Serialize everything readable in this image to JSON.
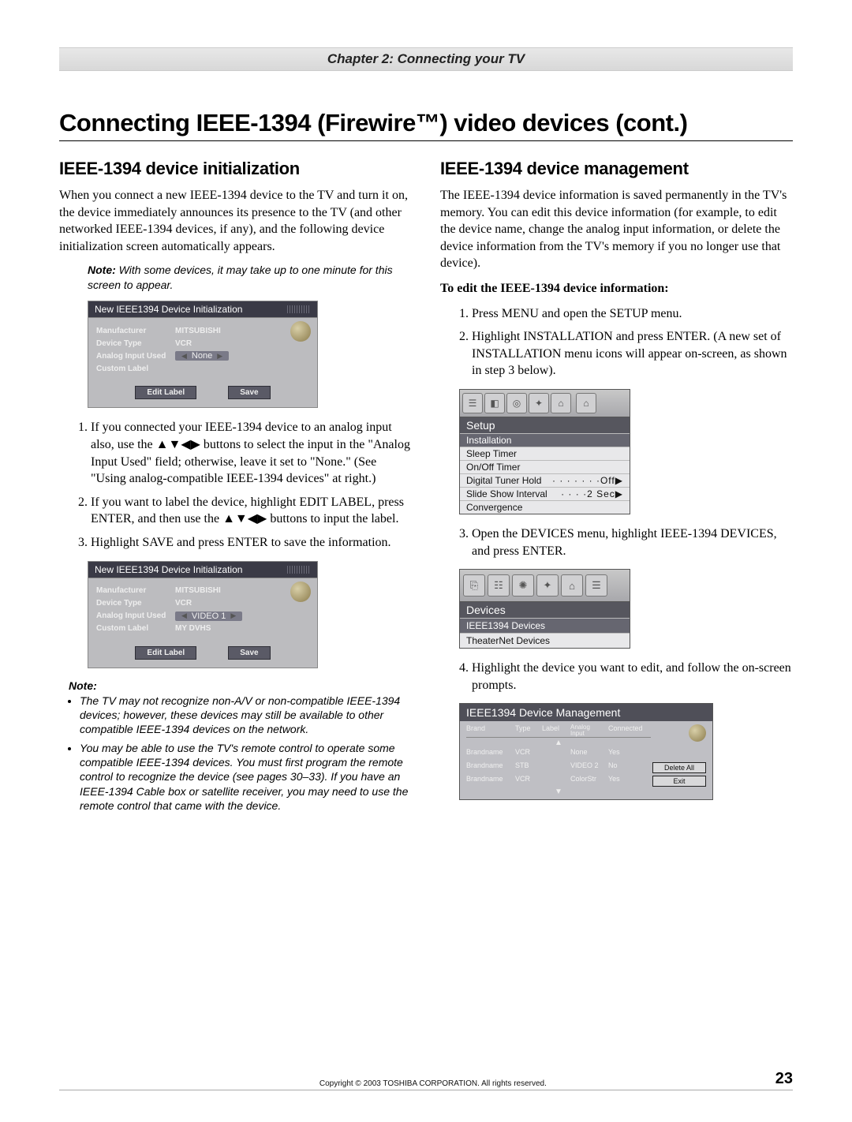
{
  "chapter_bar": "Chapter 2: Connecting your TV",
  "main_title": "Connecting IEEE-1394 (Firewire™) video devices (cont.)",
  "left": {
    "heading": "IEEE-1394 device initialization",
    "intro": "When you connect a new IEEE-1394 device to the TV and turn it on, the device immediately announces its presence to the TV (and other networked IEEE-1394 devices, if any), and the following device initialization screen automatically appears.",
    "note_lead": "Note:",
    "note_text": " With some devices, it may take up to one minute for this screen to appear.",
    "osd1": {
      "title": "New IEEE1394 Device Initialization",
      "rows": {
        "manufacturer_label": "Manufacturer",
        "manufacturer_value": "MITSUBISHI",
        "type_label": "Device Type",
        "type_value": "VCR",
        "analog_label": "Analog Input Used",
        "analog_value": "None",
        "custom_label": "Custom Label",
        "custom_value": ""
      },
      "btn_edit": "Edit Label",
      "btn_save": "Save"
    },
    "steps": [
      "If you connected your IEEE-1394 device to an analog input also, use the ▲▼◀▶ buttons to select the input in the \"Analog Input Used\" field; otherwise, leave it set to \"None.\" (See \"Using analog-compatible IEEE-1394 devices\" at right.)",
      "If you want to label the device, highlight EDIT LABEL, press ENTER, and then use the ▲▼◀▶ buttons to input the label.",
      "Highlight SAVE and press ENTER to save the information."
    ],
    "osd2": {
      "title": "New IEEE1394 Device Initialization",
      "rows": {
        "manufacturer_label": "Manufacturer",
        "manufacturer_value": "MITSUBISHI",
        "type_label": "Device Type",
        "type_value": "VCR",
        "analog_label": "Analog Input Used",
        "analog_value": "VIDEO 1",
        "custom_label": "Custom Label",
        "custom_value": "MY DVHS"
      },
      "btn_edit": "Edit Label",
      "btn_save": "Save"
    },
    "note2_head": "Note:",
    "note2_items": [
      "The TV may not recognize non-A/V or non-compatible IEEE-1394 devices; however, these devices may still be available to other compatible IEEE-1394 devices on the network.",
      "You may be able to use the TV's remote control to operate some compatible IEEE-1394 devices. You must first program the remote control to recognize the device (see pages 30–33). If you have an IEEE-1394 Cable box or satellite receiver, you may need to use the remote control that came with the device."
    ]
  },
  "right": {
    "heading": "IEEE-1394 device management",
    "intro": "The IEEE-1394 device information is saved permanently in the TV's memory. You can edit this device information (for example, to edit the device name, change the analog input information, or delete the device information from the TV's memory if you no longer use that device).",
    "subhead": "To edit the IEEE-1394 device information:",
    "steps12": [
      "Press MENU and open the SETUP menu.",
      "Highlight INSTALLATION and press ENTER. (A new set of INSTALLATION menu icons will appear on-screen, as shown in step 3 below)."
    ],
    "setup_menu": {
      "hdr": "Setup",
      "items": [
        {
          "label": "Installation",
          "hi": true,
          "suffix": ""
        },
        {
          "label": "Sleep Timer",
          "hi": false,
          "suffix": ""
        },
        {
          "label": "On/Off Timer",
          "hi": false,
          "suffix": ""
        },
        {
          "label": "Digital Tuner Hold",
          "hi": false,
          "suffix": "· · · · · · ·Off▶"
        },
        {
          "label": "Slide Show Interval",
          "hi": false,
          "suffix": "· · · ·2 Sec▶"
        },
        {
          "label": "Convergence",
          "hi": false,
          "suffix": ""
        }
      ]
    },
    "step3": "Open the DEVICES menu, highlight IEEE-1394 DEVICES, and press ENTER.",
    "devices_menu": {
      "hdr": "Devices",
      "items": [
        {
          "label": "IEEE1394 Devices",
          "hi": true
        },
        {
          "label": "TheaterNet Devices",
          "hi": false
        }
      ]
    },
    "step4": "Highlight the device you want to edit, and follow the on-screen prompts.",
    "mgmt": {
      "hdr": "IEEE1394 Device Management",
      "cols": [
        "Brand",
        "Type",
        "Label",
        "Analog\nInput",
        "Connected"
      ],
      "rows": [
        [
          "Brandname",
          "VCR",
          "",
          "None",
          "Yes"
        ],
        [
          "Brandname",
          "STB",
          "",
          "VIDEO 2",
          "No"
        ],
        [
          "Brandname",
          "VCR",
          "",
          "ColorStr",
          "Yes"
        ]
      ],
      "btn_delete": "Delete All",
      "btn_exit": "Exit"
    }
  },
  "footer": {
    "copyright": "Copyright © 2003 TOSHIBA CORPORATION. All rights reserved.",
    "page": "23"
  }
}
